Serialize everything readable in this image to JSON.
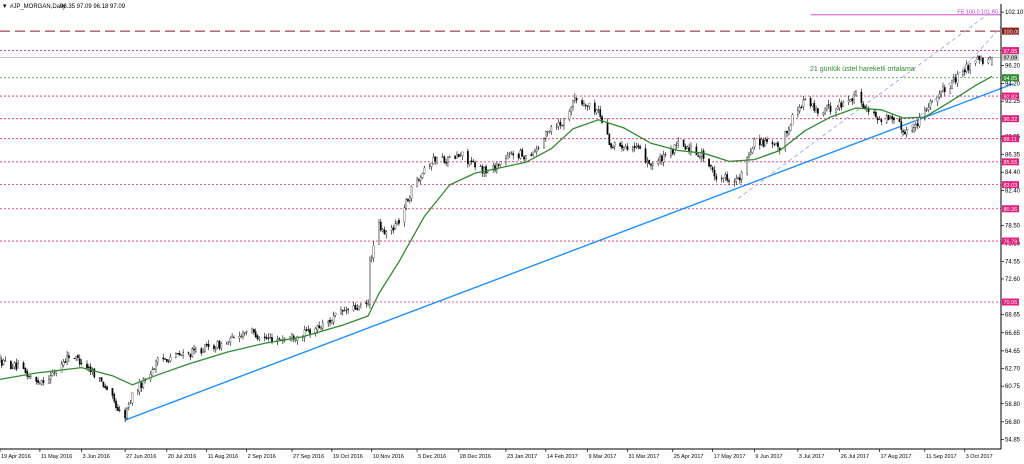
{
  "header": {
    "symbol_title": "#JP_MORGAN,Daily",
    "ohlc_text": "96.35 97.09 96.18 97.09"
  },
  "chart_data": {
    "type": "candlestick",
    "symbol": "#JP_MORGAN",
    "timeframe": "Daily",
    "last_bar": {
      "open": 96.35,
      "high": 97.09,
      "low": 96.18,
      "close": 97.09
    },
    "ylim": [
      53.8,
      103.0
    ],
    "xlim": [
      "2016-04-19",
      "2017-10-23"
    ],
    "y_ticks": [
      102.1,
      96.2,
      94.2,
      92.25,
      88.35,
      86.35,
      84.4,
      82.4,
      78.5,
      76.5,
      74.55,
      72.6,
      68.65,
      66.65,
      64.65,
      62.7,
      60.75,
      58.8,
      56.8,
      54.85
    ],
    "x_tick_labels": [
      {
        "date": "2016-04-19",
        "label": "19 Apr 2016"
      },
      {
        "date": "2016-05-11",
        "label": "11 May 2016"
      },
      {
        "date": "2016-06-03",
        "label": "3 Jun 2016"
      },
      {
        "date": "2016-06-27",
        "label": "27 Jun 2016"
      },
      {
        "date": "2016-07-20",
        "label": "20 Jul 2016"
      },
      {
        "date": "2016-08-11",
        "label": "11 Aug 2016"
      },
      {
        "date": "2016-09-02",
        "label": "2 Sep 2016"
      },
      {
        "date": "2016-09-27",
        "label": "27 Sep 2016"
      },
      {
        "date": "2016-10-19",
        "label": "19 Oct 2016"
      },
      {
        "date": "2016-11-10",
        "label": "10 Nov 2016"
      },
      {
        "date": "2016-12-05",
        "label": "5 Dec 2016"
      },
      {
        "date": "2016-12-28",
        "label": "28 Dec 2016"
      },
      {
        "date": "2017-01-23",
        "label": "23 Jan 2017"
      },
      {
        "date": "2017-02-14",
        "label": "14 Feb 2017"
      },
      {
        "date": "2017-03-09",
        "label": "9 Mar 2017"
      },
      {
        "date": "2017-03-31",
        "label": "31 Mar 2017"
      },
      {
        "date": "2017-04-25",
        "label": "25 Apr 2017"
      },
      {
        "date": "2017-05-17",
        "label": "17 May 2017"
      },
      {
        "date": "2017-06-09",
        "label": "9 Jun 2017"
      },
      {
        "date": "2017-07-03",
        "label": "3 Jul 2017"
      },
      {
        "date": "2017-07-26",
        "label": "26 Jul 2017"
      },
      {
        "date": "2017-08-17",
        "label": "17 Aug 2017"
      },
      {
        "date": "2017-09-11",
        "label": "11 Sep 2017"
      },
      {
        "date": "2017-10-03",
        "label": "3 Oct 2017"
      }
    ],
    "price_path": [
      [
        "2016-04-19",
        63.5
      ],
      [
        "2016-04-29",
        62.8
      ],
      [
        "2016-05-09",
        61.2
      ],
      [
        "2016-05-17",
        61.8
      ],
      [
        "2016-05-27",
        64.2
      ],
      [
        "2016-06-03",
        63.5
      ],
      [
        "2016-06-10",
        62.2
      ],
      [
        "2016-06-17",
        60.5
      ],
      [
        "2016-06-24",
        57.8
      ],
      [
        "2016-06-27",
        57.5
      ],
      [
        "2016-07-01",
        59.8
      ],
      [
        "2016-07-08",
        61.5
      ],
      [
        "2016-07-15",
        63.5
      ],
      [
        "2016-07-22",
        64.0
      ],
      [
        "2016-08-01",
        64.3
      ],
      [
        "2016-08-11",
        65.0
      ],
      [
        "2016-08-22",
        65.5
      ],
      [
        "2016-09-02",
        67.0
      ],
      [
        "2016-09-12",
        66.0
      ],
      [
        "2016-09-22",
        66.0
      ],
      [
        "2016-10-03",
        66.5
      ],
      [
        "2016-10-14",
        67.5
      ],
      [
        "2016-10-25",
        69.0
      ],
      [
        "2016-11-04",
        69.5
      ],
      [
        "2016-11-08",
        69.8
      ],
      [
        "2016-11-09",
        74.5
      ],
      [
        "2016-11-14",
        78.5
      ],
      [
        "2016-11-17",
        77.5
      ],
      [
        "2016-11-25",
        79.0
      ],
      [
        "2016-12-02",
        82.5
      ],
      [
        "2016-12-09",
        85.0
      ],
      [
        "2016-12-16",
        86.0
      ],
      [
        "2016-12-22",
        85.8
      ],
      [
        "2016-12-30",
        86.3
      ],
      [
        "2017-01-06",
        85.0
      ],
      [
        "2017-01-13",
        84.5
      ],
      [
        "2017-01-20",
        85.5
      ],
      [
        "2017-01-27",
        86.5
      ],
      [
        "2017-02-03",
        86.2
      ],
      [
        "2017-02-10",
        87.2
      ],
      [
        "2017-02-17",
        89.5
      ],
      [
        "2017-02-24",
        90.0
      ],
      [
        "2017-03-01",
        92.5
      ],
      [
        "2017-03-08",
        91.8
      ],
      [
        "2017-03-15",
        91.2
      ],
      [
        "2017-03-22",
        87.3
      ],
      [
        "2017-03-29",
        87.5
      ],
      [
        "2017-04-05",
        87.0
      ],
      [
        "2017-04-13",
        85.3
      ],
      [
        "2017-04-21",
        86.0
      ],
      [
        "2017-04-28",
        87.5
      ],
      [
        "2017-05-05",
        87.0
      ],
      [
        "2017-05-12",
        86.2
      ],
      [
        "2017-05-18",
        84.0
      ],
      [
        "2017-05-26",
        83.8
      ],
      [
        "2017-06-01",
        83.5
      ],
      [
        "2017-06-09",
        88.0
      ],
      [
        "2017-06-16",
        87.5
      ],
      [
        "2017-06-23",
        87.0
      ],
      [
        "2017-06-30",
        90.5
      ],
      [
        "2017-07-07",
        92.5
      ],
      [
        "2017-07-14",
        91.0
      ],
      [
        "2017-07-21",
        91.5
      ],
      [
        "2017-07-28",
        92.0
      ],
      [
        "2017-08-04",
        93.0
      ],
      [
        "2017-08-11",
        91.0
      ],
      [
        "2017-08-18",
        90.3
      ],
      [
        "2017-08-25",
        90.5
      ],
      [
        "2017-08-30",
        89.0
      ],
      [
        "2017-09-05",
        89.2
      ],
      [
        "2017-09-11",
        91.5
      ],
      [
        "2017-09-18",
        93.0
      ],
      [
        "2017-09-25",
        94.0
      ],
      [
        "2017-10-02",
        95.5
      ],
      [
        "2017-10-09",
        97.0
      ],
      [
        "2017-10-16",
        96.5
      ],
      [
        "2017-10-18",
        97.09
      ]
    ],
    "ema_21": [
      [
        "2016-04-19",
        61.5
      ],
      [
        "2016-05-09",
        62.2
      ],
      [
        "2016-06-03",
        62.8
      ],
      [
        "2016-06-20",
        61.9
      ],
      [
        "2016-07-01",
        60.9
      ],
      [
        "2016-07-15",
        62.0
      ],
      [
        "2016-08-01",
        63.2
      ],
      [
        "2016-08-22",
        64.5
      ],
      [
        "2016-09-12",
        65.5
      ],
      [
        "2016-10-03",
        66.2
      ],
      [
        "2016-10-25",
        67.5
      ],
      [
        "2016-11-08",
        68.5
      ],
      [
        "2016-11-14",
        71.0
      ],
      [
        "2016-11-25",
        74.5
      ],
      [
        "2016-12-09",
        79.5
      ],
      [
        "2016-12-23",
        83.0
      ],
      [
        "2017-01-06",
        84.3
      ],
      [
        "2017-01-20",
        84.9
      ],
      [
        "2017-02-03",
        85.5
      ],
      [
        "2017-02-17",
        87.0
      ],
      [
        "2017-03-01",
        89.2
      ],
      [
        "2017-03-15",
        90.2
      ],
      [
        "2017-03-29",
        89.3
      ],
      [
        "2017-04-13",
        87.6
      ],
      [
        "2017-04-28",
        86.8
      ],
      [
        "2017-05-12",
        86.5
      ],
      [
        "2017-05-26",
        85.6
      ],
      [
        "2017-06-09",
        85.8
      ],
      [
        "2017-06-23",
        86.8
      ],
      [
        "2017-07-07",
        89.0
      ],
      [
        "2017-07-21",
        90.5
      ],
      [
        "2017-08-04",
        91.5
      ],
      [
        "2017-08-18",
        91.3
      ],
      [
        "2017-08-30",
        90.4
      ],
      [
        "2017-09-11",
        90.5
      ],
      [
        "2017-09-25",
        92.2
      ],
      [
        "2017-10-09",
        94.0
      ],
      [
        "2017-10-18",
        95.0
      ]
    ],
    "ema_label": "21 günlük üstel hareketli ortalama",
    "trendline": {
      "from": [
        "2016-06-27",
        57.0
      ],
      "to": [
        "2017-10-30",
        94.2
      ],
      "color": "#1e90ff"
    },
    "channel_lines": [
      {
        "from": [
          "2017-05-31",
          81.5
        ],
        "to": [
          "2017-10-20",
          102.5
        ],
        "color": "#9aa7e8"
      },
      {
        "from": [
          "2017-08-29",
          88.3
        ],
        "to": [
          "2017-10-23",
          100.5
        ],
        "color": "#9aa7e8"
      }
    ],
    "horizontal_levels": [
      {
        "price": 100.0,
        "label": "100.00",
        "style": "long-dash",
        "color": "#8b1a1a"
      },
      {
        "price": 97.85,
        "label": "97.85",
        "style": "dotted",
        "color": "#e0207a"
      },
      {
        "price": 97.09,
        "label": "97.09",
        "style": "solid",
        "color": "#bbbbbb",
        "current": true
      },
      {
        "price": 94.85,
        "label": "94.85",
        "style": "dotted",
        "color": "#2e8b2e"
      },
      {
        "price": 92.82,
        "label": "92.82",
        "style": "dotted",
        "color": "#e0207a"
      },
      {
        "price": 90.32,
        "label": "90.32",
        "style": "dotted",
        "color": "#e0207a"
      },
      {
        "price": 88.11,
        "label": "88.11",
        "style": "dotted",
        "color": "#e0207a"
      },
      {
        "price": 85.55,
        "label": "85.55",
        "style": "dotted",
        "color": "#e0207a"
      },
      {
        "price": 83.03,
        "label": "83.03",
        "style": "dotted",
        "color": "#e0207a"
      },
      {
        "price": 80.36,
        "label": "80.36",
        "style": "dotted",
        "color": "#e0207a"
      },
      {
        "price": 76.79,
        "label": "76.79",
        "style": "dotted",
        "color": "#e0207a"
      },
      {
        "price": 70.05,
        "label": "70.05",
        "style": "dotted",
        "color": "#e0207a"
      }
    ],
    "fibo_extension": {
      "price": 101.8,
      "start": "2017-07-10",
      "label": "FE 100.0 101.60",
      "color": "#cc33cc"
    },
    "colors": {
      "candle": "#000000",
      "ema": "#2e8b2e",
      "axis": "#000000",
      "background": "#ffffff"
    },
    "grid": false
  }
}
